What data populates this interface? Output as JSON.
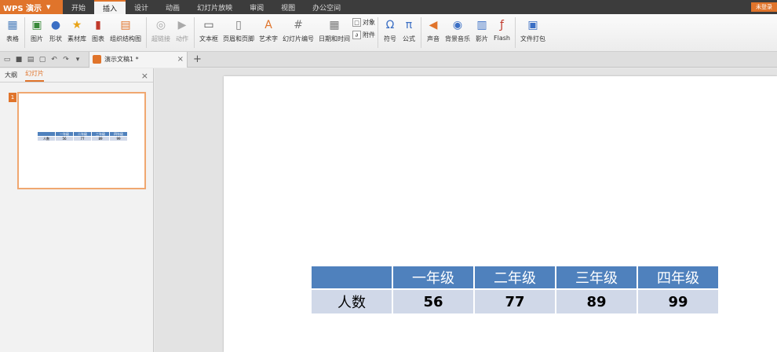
{
  "app": {
    "name": "WPS 演示",
    "login": "未登录"
  },
  "menu": [
    "开始",
    "插入",
    "设计",
    "动画",
    "幻灯片放映",
    "审阅",
    "视图",
    "办公空间"
  ],
  "active_menu_index": 1,
  "ribbon": {
    "table": "表格",
    "picture": "图片",
    "shape": "形状",
    "material": "素材库",
    "chart": "图表",
    "smartart": "组织结构图",
    "hyperlink": "超链接",
    "action": "动作",
    "textbox": "文本框",
    "header_footer": "页眉和页脚",
    "wordart": "艺术字",
    "slide_number": "幻灯片编号",
    "datetime": "日期和时间",
    "object": "对象",
    "attachment": "附件",
    "symbol": "符号",
    "formula": "公式",
    "sound": "声音",
    "bg_music": "背景音乐",
    "movie": "影片",
    "flash": "Flash",
    "package": "文件打包"
  },
  "doc_tab": {
    "name": "演示文稿1 *"
  },
  "panel": {
    "tab_outline": "大纲",
    "tab_slides": "幻灯片",
    "slide_number": "1"
  },
  "table": {
    "headers": [
      "",
      "一年级",
      "二年级",
      "三年级",
      "四年级"
    ],
    "row_label": "人数",
    "values": [
      "56",
      "77",
      "89",
      "99"
    ]
  }
}
